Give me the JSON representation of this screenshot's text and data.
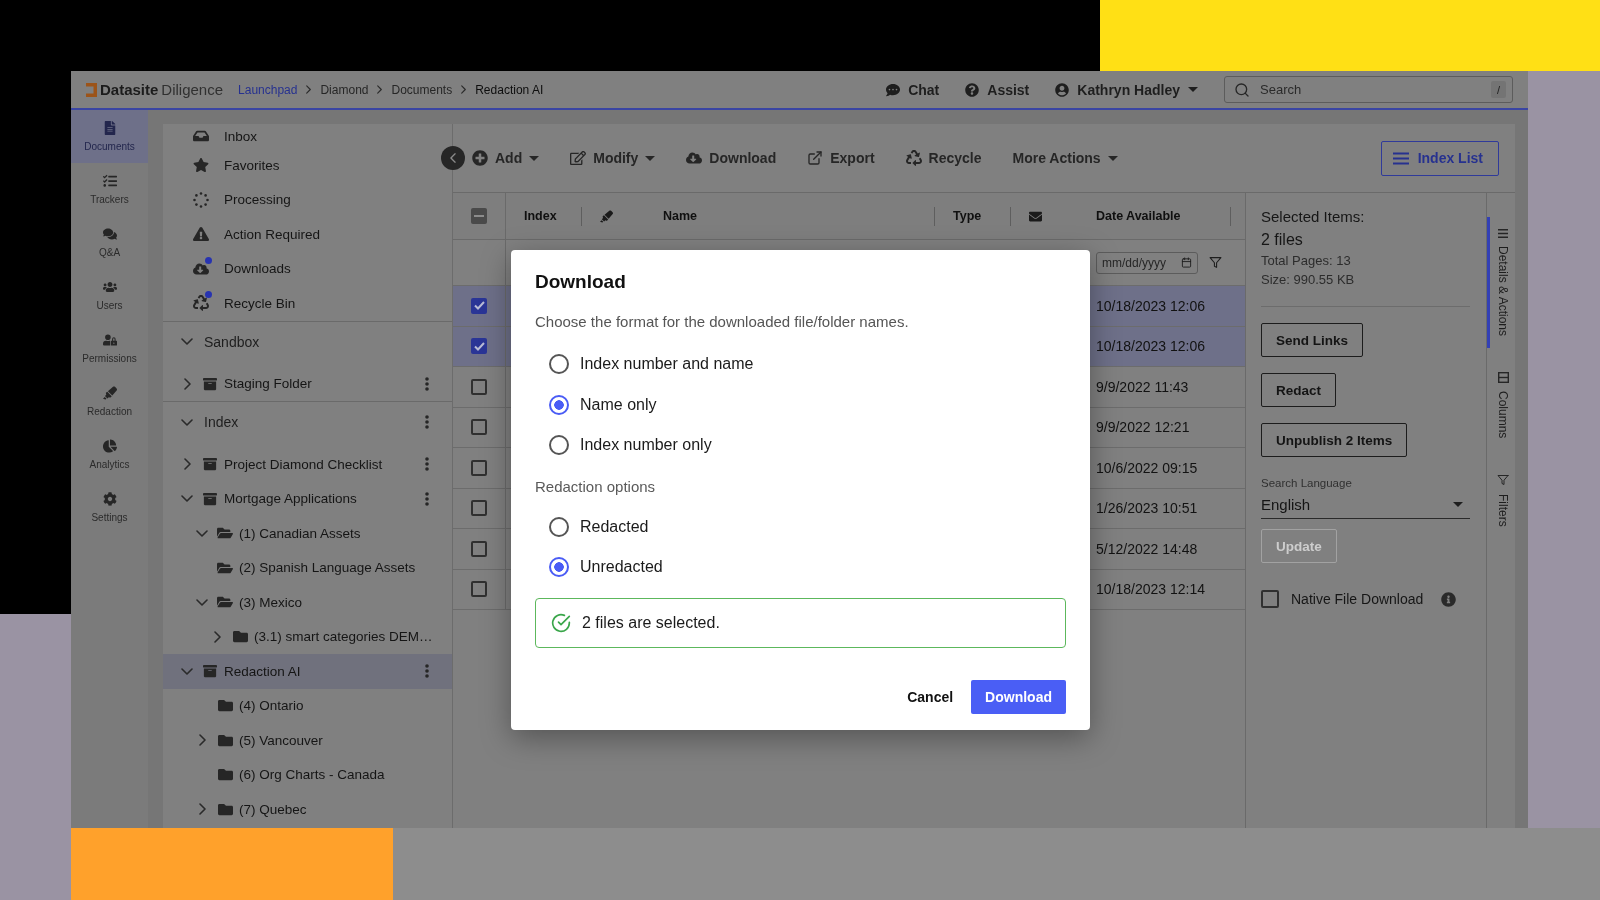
{
  "top_bar": {
    "logo": {
      "brand": "Datasite",
      "product": "Diligence"
    },
    "breadcrumb": [
      {
        "label": "Launchpad",
        "kind": "link"
      },
      {
        "label": "Diamond",
        "kind": "crumb"
      },
      {
        "label": "Documents",
        "kind": "crumb"
      },
      {
        "label": "Redaction AI",
        "kind": "current"
      }
    ],
    "actions": [
      {
        "label": "Chat"
      },
      {
        "label": "Assist"
      }
    ],
    "user": {
      "name": "Kathryn Hadley"
    },
    "search": {
      "placeholder": "Search",
      "shortcut": "/"
    }
  },
  "rail": [
    {
      "label": "Documents",
      "selected": true
    },
    {
      "label": "Trackers",
      "selected": false
    },
    {
      "label": "Q&A",
      "selected": false
    },
    {
      "label": "Users",
      "selected": false
    },
    {
      "label": "Permissions",
      "selected": false
    },
    {
      "label": "Redaction",
      "selected": false
    },
    {
      "label": "Analytics",
      "selected": false
    },
    {
      "label": "Settings",
      "selected": false
    }
  ],
  "quick_links": [
    {
      "label": "Inbox",
      "badge": false
    },
    {
      "label": "Favorites",
      "badge": false
    },
    {
      "label": "Processing",
      "badge": false
    },
    {
      "label": "Action Required",
      "badge": false
    },
    {
      "label": "Downloads",
      "badge": true
    },
    {
      "label": "Recycle Bin",
      "badge": true
    }
  ],
  "tree": [
    {
      "label": "Sandbox",
      "expanded": true,
      "menu": false,
      "selected": false,
      "children": [
        {
          "label": "Staging Folder",
          "kind": "binder",
          "expanded": false,
          "menu": true,
          "selected": false
        }
      ]
    },
    {
      "label": "Index",
      "expanded": true,
      "menu": true,
      "selected": false,
      "children": [
        {
          "label": "Project Diamond Checklist",
          "kind": "binder",
          "expanded": false,
          "menu": true,
          "selected": false
        },
        {
          "label": "Mortgage Applications",
          "kind": "binder",
          "expanded": true,
          "menu": true,
          "selected": false,
          "children": [
            {
              "label": "(1) Canadian Assets",
              "kind": "open-folder",
              "expanded": true,
              "menu": false,
              "selected": false
            },
            {
              "label": "(2) Spanish Language Assets",
              "kind": "open-folder",
              "menu": false,
              "selected": false
            },
            {
              "label": "(3) Mexico",
              "kind": "open-folder",
              "expanded": true,
              "menu": false,
              "selected": false,
              "children": [
                {
                  "label": "(3.1) smart categories DEM…",
                  "kind": "folder",
                  "expanded": false,
                  "menu": false,
                  "selected": false
                }
              ]
            }
          ]
        },
        {
          "label": "Redaction AI",
          "kind": "binder",
          "expanded": true,
          "menu": true,
          "selected": true,
          "children": [
            {
              "label": "(4) Ontario",
              "kind": "folder",
              "menu": false,
              "selected": false
            },
            {
              "label": "(5) Vancouver",
              "kind": "folder",
              "expanded": false,
              "menu": false,
              "selected": false
            },
            {
              "label": "(6) Org Charts - Canada",
              "kind": "folder",
              "menu": false,
              "selected": false
            },
            {
              "label": "(7) Quebec",
              "kind": "folder",
              "expanded": false,
              "menu": false,
              "selected": false
            }
          ]
        }
      ]
    }
  ],
  "toolbar": {
    "actions": [
      {
        "label": "Add",
        "dropdown": true
      },
      {
        "label": "Modify",
        "dropdown": true
      },
      {
        "label": "Download",
        "dropdown": false
      },
      {
        "label": "Export",
        "dropdown": false
      },
      {
        "label": "Recycle",
        "dropdown": false
      },
      {
        "label": "More Actions",
        "dropdown": true
      }
    ],
    "view_button": {
      "label": "Index List"
    }
  },
  "table": {
    "select_all": {
      "indeterminate": true
    },
    "columns": [
      {
        "kind": "text",
        "label": "Index"
      },
      {
        "kind": "icon"
      },
      {
        "kind": "text",
        "label": "Name"
      },
      {
        "kind": "text",
        "label": "Type"
      },
      {
        "kind": "icon"
      },
      {
        "kind": "text",
        "label": "Date Available"
      }
    ],
    "date_filter": {
      "placeholder": "mm/dd/yyyy"
    },
    "rows": [
      {
        "selected": true,
        "date_available": "10/18/2023 12:06"
      },
      {
        "selected": true,
        "date_available": "10/18/2023 12:06"
      },
      {
        "selected": false,
        "date_available": "9/9/2022 11:43"
      },
      {
        "selected": false,
        "date_available": "9/9/2022 12:21"
      },
      {
        "selected": false,
        "date_available": "10/6/2022 09:15"
      },
      {
        "selected": false,
        "date_available": "1/26/2023 10:51"
      },
      {
        "selected": false,
        "date_available": "5/12/2022 14:48"
      },
      {
        "selected": false,
        "date_available": "10/18/2023 12:14"
      }
    ]
  },
  "details": {
    "title": "Selected Items:",
    "count": "2 files",
    "meta": [
      "Total Pages: 13",
      "Size: 990.55 KB"
    ],
    "actions": [
      "Send Links",
      "Redact",
      "Unpublish 2 Items"
    ],
    "language": {
      "label": "Search Language",
      "value": "English"
    },
    "update": {
      "label": "Update",
      "disabled": true
    },
    "native_download": {
      "label": "Native File Download",
      "checked": false
    }
  },
  "side_tabs": [
    {
      "label": "Details & Actions",
      "selected": true
    },
    {
      "label": "Columns",
      "selected": false
    },
    {
      "label": "Filters",
      "selected": false
    }
  ],
  "dialog": {
    "title": "Download",
    "description": "Choose the format for the downloaded file/folder names.",
    "name_format": [
      {
        "label": "Index number and name",
        "selected": false
      },
      {
        "label": "Name only",
        "selected": true
      },
      {
        "label": "Index number only",
        "selected": false
      }
    ],
    "redaction_heading": "Redaction options",
    "redaction": [
      {
        "label": "Redacted",
        "selected": false
      },
      {
        "label": "Unredacted",
        "selected": true
      }
    ],
    "notice": "2 files are selected.",
    "buttons": [
      {
        "label": "Cancel",
        "kind": "text"
      },
      {
        "label": "Download",
        "kind": "primary"
      }
    ]
  }
}
